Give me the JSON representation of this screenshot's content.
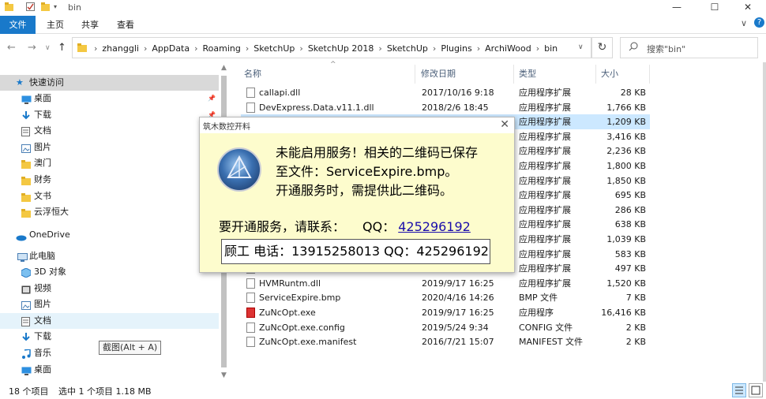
{
  "window": {
    "title": "bin",
    "minimize": "—",
    "maximize": "☐",
    "close": "✕"
  },
  "ribbon": {
    "tabs": [
      "文件",
      "主页",
      "共享",
      "查看"
    ],
    "collapse": "∨",
    "help": "?"
  },
  "address": {
    "back": "←",
    "forward": "→",
    "dropdown": "∨",
    "up": "↑",
    "crumbs": [
      "zhanggli",
      "AppData",
      "Roaming",
      "SketchUp",
      "SketchUp 2018",
      "SketchUp",
      "Plugins",
      "ArchiWood",
      "bin"
    ],
    "separator": "›",
    "dropdown_arrow": "∨",
    "refresh": "↻",
    "search_placeholder": "搜索\"bin\""
  },
  "navpane": {
    "quick_access": "快速访问",
    "items": [
      {
        "label": "桌面",
        "icon": "desktop-icon",
        "pinned": true
      },
      {
        "label": "下载",
        "icon": "download-icon",
        "pinned": true
      },
      {
        "label": "文档",
        "icon": "document-icon",
        "pinned": true
      },
      {
        "label": "图片",
        "icon": "picture-icon",
        "pinned": true
      },
      {
        "label": "澳门",
        "icon": "folder-icon",
        "pinned": false
      },
      {
        "label": "财务",
        "icon": "folder-icon",
        "pinned": false
      },
      {
        "label": "文书",
        "icon": "folder-icon",
        "pinned": false
      },
      {
        "label": "云浮恒大",
        "icon": "folder-icon",
        "pinned": false
      }
    ],
    "onedrive": "OneDrive",
    "this_pc": "此电脑",
    "pc_items": [
      {
        "label": "3D 对象",
        "icon": "3d-objects-icon"
      },
      {
        "label": "视频",
        "icon": "video-icon"
      },
      {
        "label": "图片",
        "icon": "picture-icon"
      },
      {
        "label": "文档",
        "icon": "document-icon"
      },
      {
        "label": "下载",
        "icon": "download-icon"
      },
      {
        "label": "音乐",
        "icon": "music-icon"
      },
      {
        "label": "桌面",
        "icon": "desktop-icon"
      }
    ],
    "pin_glyph": "📌"
  },
  "filelist": {
    "columns": {
      "name": "名称",
      "date": "修改日期",
      "type": "类型",
      "size": "大小"
    },
    "sort_glyph": "^",
    "rows": [
      {
        "name": "callapi.dll",
        "date": "2017/10/16 9:18",
        "type": "应用程序扩展",
        "size": "28 KB",
        "kind": "dll"
      },
      {
        "name": "DevExpress.Data.v11.1.dll",
        "date": "2018/2/6 18:45",
        "type": "应用程序扩展",
        "size": "1,766 KB",
        "kind": "dll"
      },
      {
        "name": "",
        "date": "",
        "type": "应用程序扩展",
        "size": "1,209 KB",
        "kind": "dll",
        "selected": true
      },
      {
        "name": "",
        "date": "",
        "type": "应用程序扩展",
        "size": "3,416 KB",
        "kind": "dll"
      },
      {
        "name": "",
        "date": "",
        "type": "应用程序扩展",
        "size": "2,236 KB",
        "kind": "dll"
      },
      {
        "name": "",
        "date": "",
        "type": "应用程序扩展",
        "size": "1,800 KB",
        "kind": "dll"
      },
      {
        "name": "",
        "date": "",
        "type": "应用程序扩展",
        "size": "1,850 KB",
        "kind": "dll"
      },
      {
        "name": "",
        "date": "",
        "type": "应用程序扩展",
        "size": "695 KB",
        "kind": "dll"
      },
      {
        "name": "",
        "date": "",
        "type": "应用程序扩展",
        "size": "286 KB",
        "kind": "dll"
      },
      {
        "name": "",
        "date": "",
        "type": "应用程序扩展",
        "size": "638 KB",
        "kind": "dll"
      },
      {
        "name": "",
        "date": "",
        "type": "应用程序扩展",
        "size": "1,039 KB",
        "kind": "dll"
      },
      {
        "name": "",
        "date": "",
        "type": "应用程序扩展",
        "size": "583 KB",
        "kind": "dll"
      },
      {
        "name": "",
        "date": "",
        "type": "应用程序扩展",
        "size": "497 KB",
        "kind": "dll"
      },
      {
        "name": "HVMRuntm.dll",
        "date": "2019/9/17 16:25",
        "type": "应用程序扩展",
        "size": "1,520 KB",
        "kind": "dll"
      },
      {
        "name": "ServiceExpire.bmp",
        "date": "2020/4/16 14:26",
        "type": "BMP 文件",
        "size": "7 KB",
        "kind": "bmp"
      },
      {
        "name": "ZuNcOpt.exe",
        "date": "2019/9/17 16:25",
        "type": "应用程序",
        "size": "16,416 KB",
        "kind": "exe"
      },
      {
        "name": "ZuNcOpt.exe.config",
        "date": "2019/5/24 9:34",
        "type": "CONFIG 文件",
        "size": "2 KB",
        "kind": "config"
      },
      {
        "name": "ZuNcOpt.exe.manifest",
        "date": "2016/7/21 15:07",
        "type": "MANIFEST 文件",
        "size": "2 KB",
        "kind": "manifest"
      }
    ]
  },
  "tooltip": "截图(Alt + A)",
  "status": {
    "count": "18 个项目",
    "selection": "选中 1 个项目  1.18 MB"
  },
  "dialog": {
    "title": "筑木数控开料",
    "close": "✕",
    "message_line1": "未能启用服务！相关的二维码已保存",
    "message_line2": "至文件：ServiceExpire.bmp。",
    "message_line3": "开通服务时，需提供此二维码。",
    "contact_label": "要开通服务，请联系：",
    "qq_label": "QQ：",
    "qq_number": "425296192",
    "phone_line": "顾工  电话：13915258013 QQ：425296192"
  }
}
